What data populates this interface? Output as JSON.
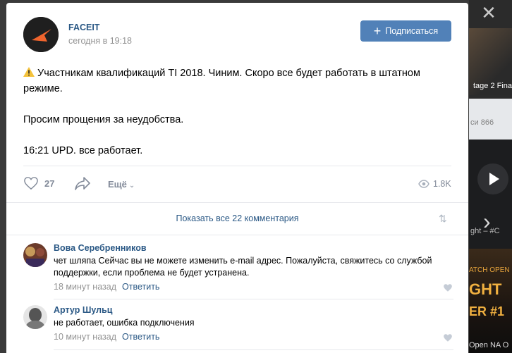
{
  "post": {
    "author": "FACEIT",
    "time": "сегодня в 19:18",
    "subscribe_label": "Подписаться",
    "text_lines": [
      "Участникам квалификаций TI 2018. Чиним. Скоро все будет работать в штатном режиме.",
      "Просим прощения за неудобства.",
      "16:21 UPD. все работает."
    ],
    "likes": "27",
    "more_label": "Ещё",
    "views": "1.8K"
  },
  "comments_bar": {
    "show_all": "Показать все 22 комментария"
  },
  "comments": [
    {
      "author": "Вова Серебренников",
      "text": "чет шляпа Сейчас вы не можете изменить e-mail адрес. Пожалуйста, свяжитесь со службой поддержки, если проблема не будет устранена.",
      "time": "18 минут назад",
      "reply": "Ответить"
    },
    {
      "author": "Артур Шульц",
      "text": "не работает, ошибка подключения",
      "time": "10 минут назад",
      "reply": "Ответить"
    }
  ],
  "background": {
    "label1": "tage 2 Fina",
    "label2": "си",
    "label2_count": "866",
    "label3": "ght",
    "label3_suffix": "#C",
    "ow_text1": "ATCH OPEN",
    "ow_text2": "GHT",
    "ow_text3": "ER #1",
    "label4": "Open NA O"
  },
  "colors": {
    "link": "#2a5885",
    "button": "#5181b8",
    "muted": "#939393",
    "logo_accent": "#f0642d"
  }
}
